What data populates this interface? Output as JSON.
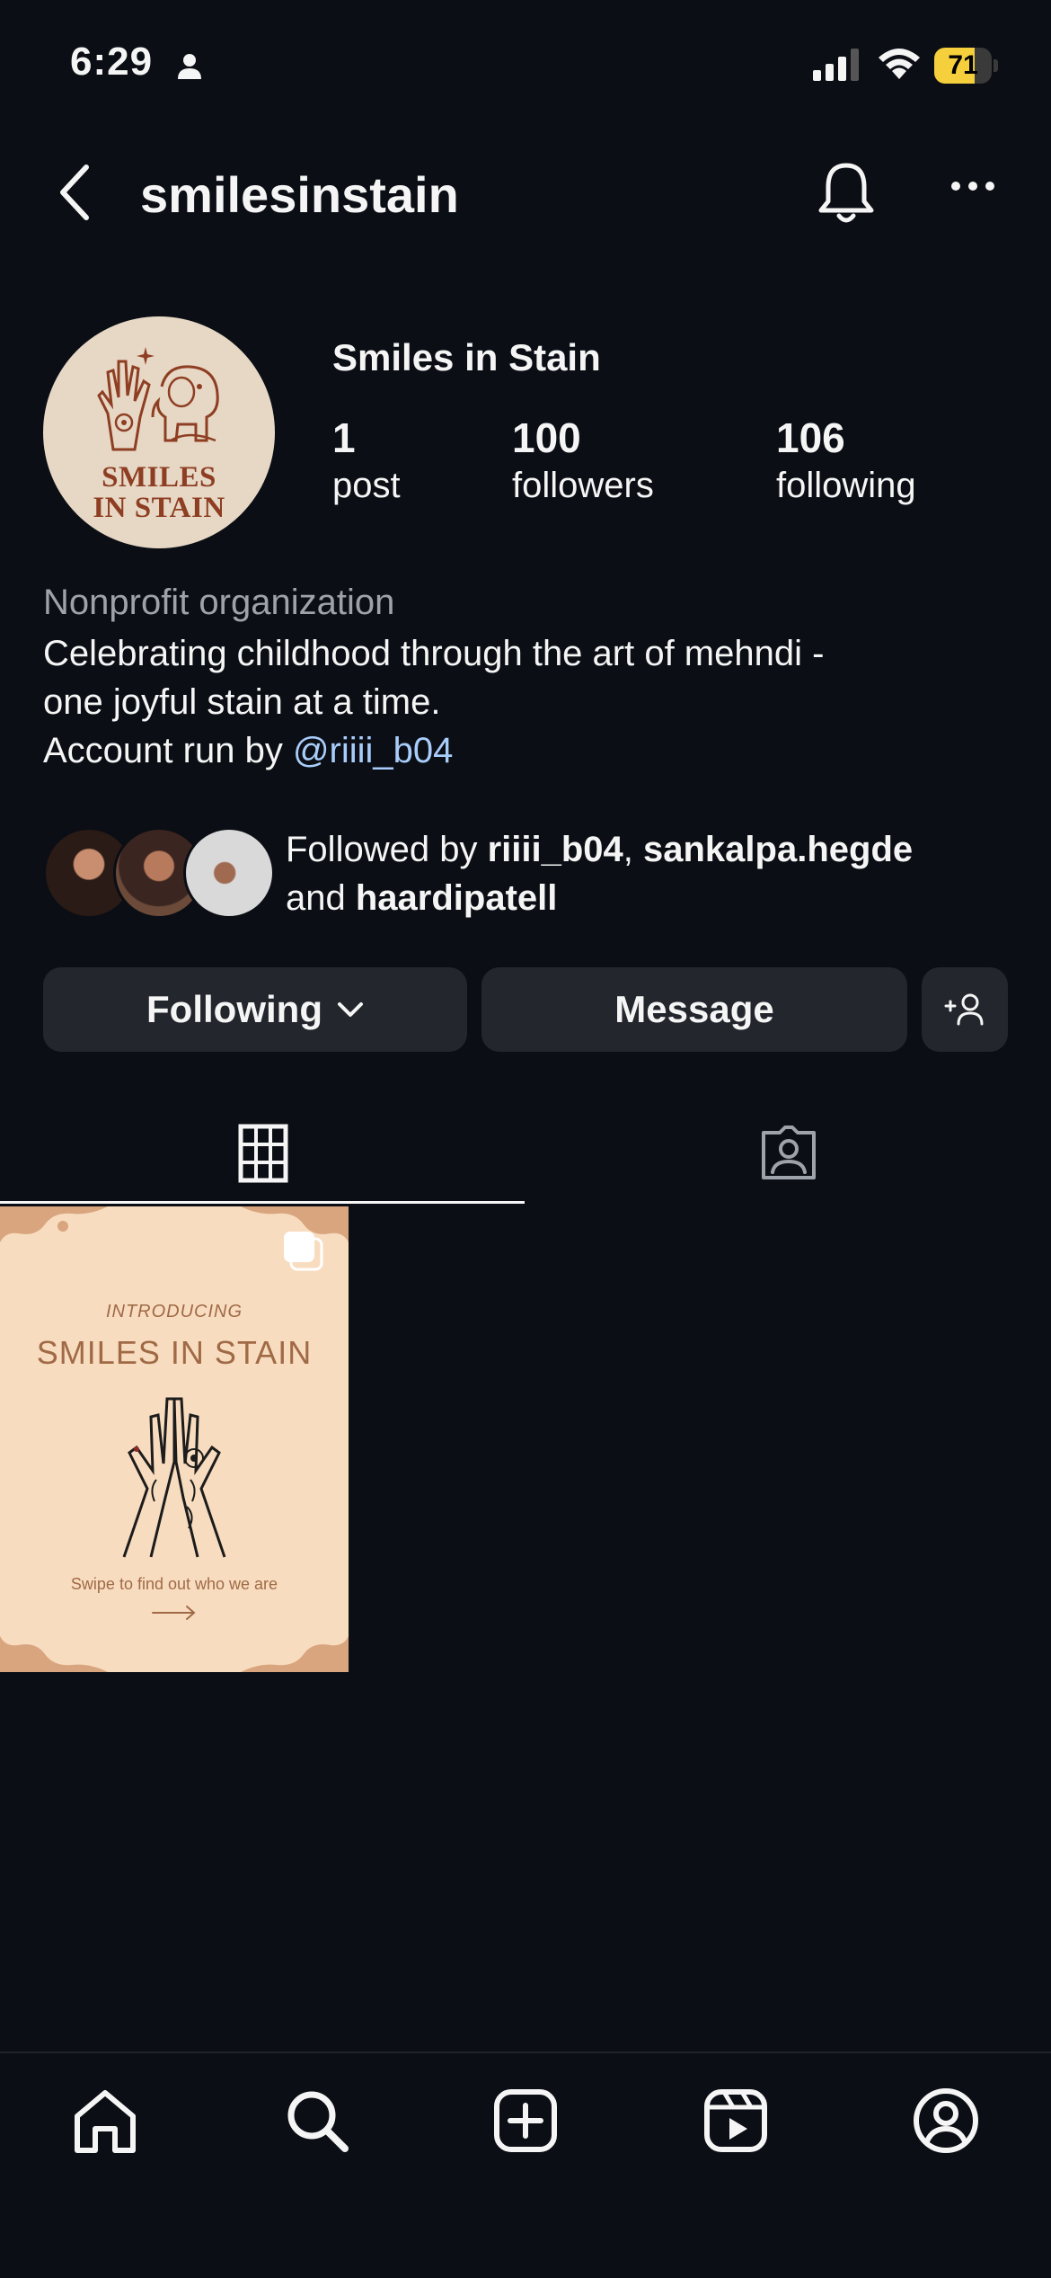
{
  "status_bar": {
    "time": "6:29",
    "battery": "71",
    "battery_level": 0.71,
    "icons": [
      "person-icon",
      "signal-icon",
      "wifi-icon",
      "battery-icon"
    ]
  },
  "header": {
    "username": "smilesinstain",
    "icons": [
      "back-arrow-icon",
      "bell-icon",
      "more-icon"
    ]
  },
  "profile": {
    "avatar_text_line1": "SMILES",
    "avatar_text_line2": "IN STAIN",
    "display_name": "Smiles in Stain",
    "stats": [
      {
        "value": "1",
        "label": "post"
      },
      {
        "value": "100",
        "label": "followers"
      },
      {
        "value": "106",
        "label": "following"
      }
    ],
    "category": "Nonprofit organization",
    "bio_line1": "Celebrating childhood through the art of mehndi -",
    "bio_line2": "one joyful stain at a time.",
    "bio_line3_prefix": "Account run by ",
    "bio_mention": "@riiii_b04"
  },
  "followed_by": {
    "prefix": "Followed by ",
    "user1": "riiii_b04",
    "sep": ", ",
    "user2": "sankalpa.hegde",
    "and": "and ",
    "user3": "haardipatell"
  },
  "actions": {
    "following_label": "Following",
    "message_label": "Message",
    "add_user_icon": "add-user-icon"
  },
  "tabs": [
    {
      "icon": "grid-icon",
      "active": true
    },
    {
      "icon": "tagged-icon",
      "active": false
    }
  ],
  "post": {
    "small_text": "INTRODUCING",
    "title": "SMILES IN STAIN",
    "caption": "Swipe to find out who we are",
    "multi_icon": "carousel-icon"
  },
  "bottom_nav": [
    "home-icon",
    "search-icon",
    "create-icon",
    "reels-icon",
    "profile-icon"
  ],
  "colors": {
    "background": "#0b0e14",
    "button": "#23262d",
    "mention": "#a9cdfb",
    "battery": "#f5cf3c",
    "post_bg": "#f8dcbf",
    "brand_brown": "#8e3e22"
  }
}
